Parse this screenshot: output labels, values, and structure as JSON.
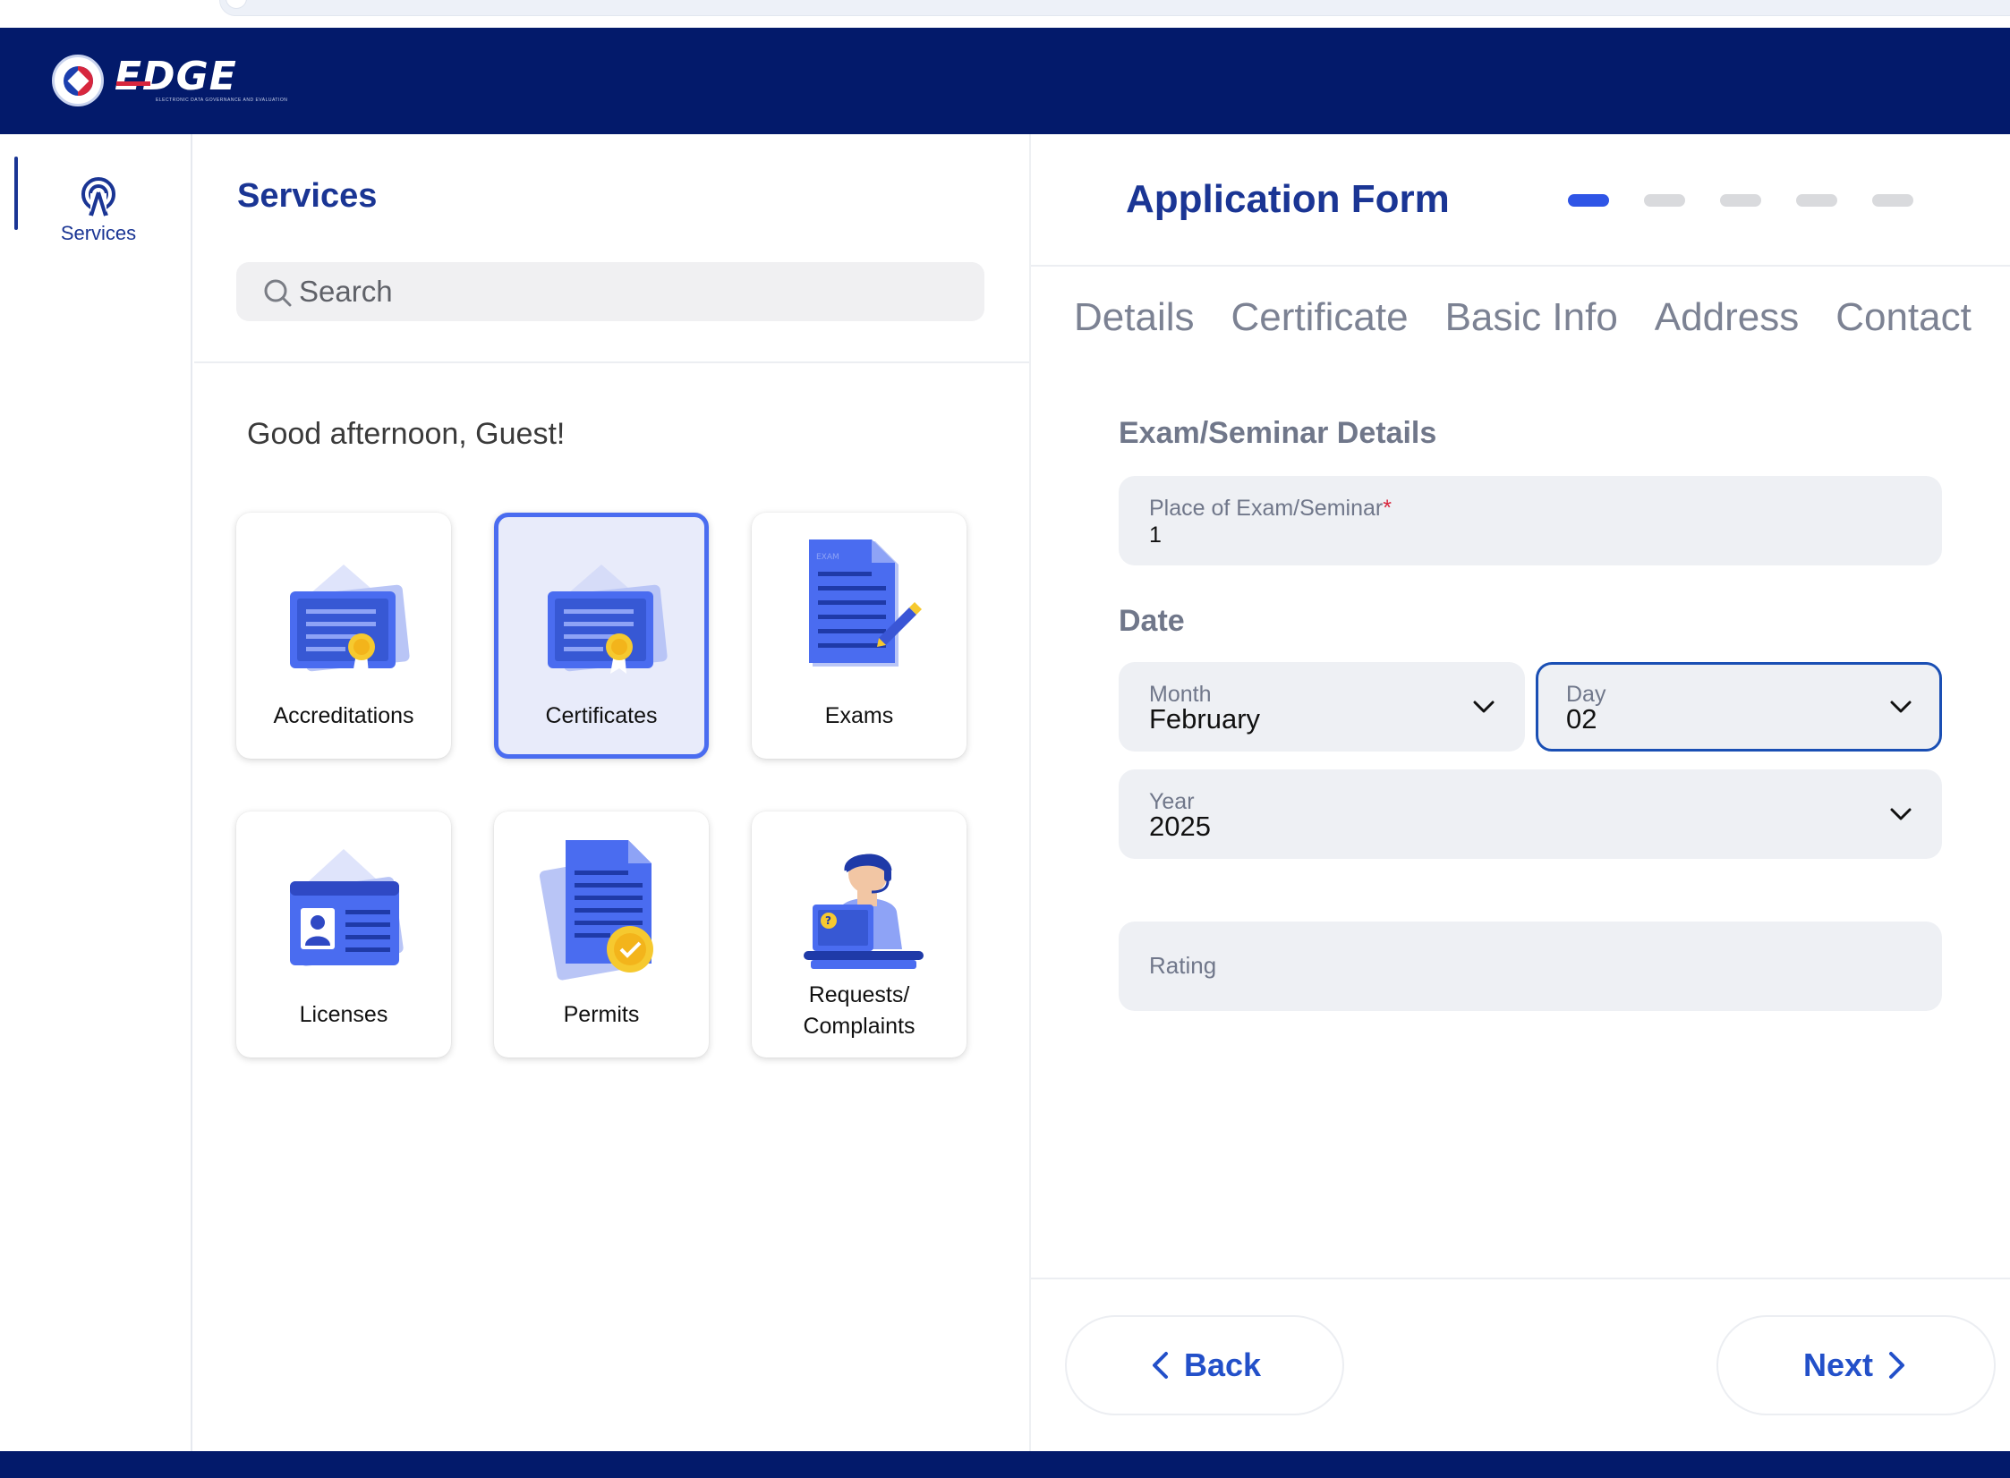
{
  "header": {
    "logo_text": "EDGE",
    "logo_subtitle": "ELECTRONIC DATA GOVERNANCE AND EVALUATION",
    "brand_color": "#031a6b"
  },
  "rail": {
    "items": [
      {
        "label": "Services",
        "icon": "services-icon",
        "active": true
      }
    ]
  },
  "services": {
    "title": "Services",
    "search_placeholder": "Search",
    "greeting": "Good afternoon, Guest!",
    "cards": [
      {
        "label": "Accreditations",
        "icon": "accreditation-certificate-icon",
        "selected": false
      },
      {
        "label": "Certificates",
        "icon": "certificate-icon",
        "selected": true
      },
      {
        "label": "Exams",
        "icon": "exam-document-icon",
        "selected": false
      },
      {
        "label": "Licenses",
        "icon": "license-id-card-icon",
        "selected": false
      },
      {
        "label": "Permits",
        "icon": "permit-document-icon",
        "selected": false
      },
      {
        "label": "Requests/\nComplaints",
        "label_line1": "Requests/",
        "label_line2": "Complaints",
        "icon": "support-agent-icon",
        "selected": false
      }
    ],
    "selected_color": "#4a6cf0"
  },
  "form": {
    "title": "Application Form",
    "steps_total": 5,
    "current_step": 1,
    "tabs": [
      "Details",
      "Certificate",
      "Basic Info",
      "Address",
      "Contact"
    ],
    "section_exam": "Exam/Seminar Details",
    "place_label": "Place of Exam/Seminar",
    "place_required_mark": "*",
    "place_value": "1",
    "section_date": "Date",
    "month_label": "Month",
    "month_value": "February",
    "day_label": "Day",
    "day_value": "02",
    "year_label": "Year",
    "year_value": "2025",
    "rating_placeholder": "Rating",
    "back_label": "Back",
    "next_label": "Next",
    "accent_color": "#2350c9"
  }
}
